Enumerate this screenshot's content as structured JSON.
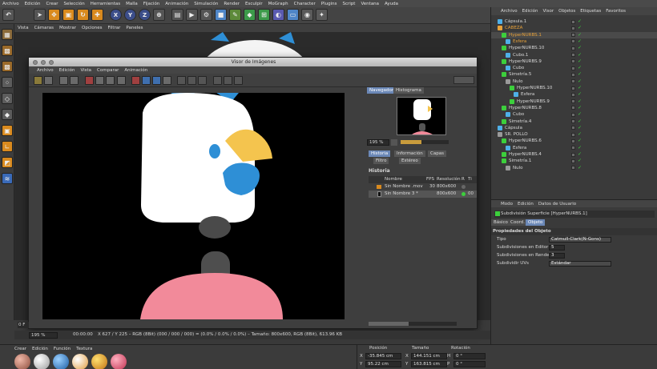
{
  "menubar": [
    "Archivo",
    "Edición",
    "Crear",
    "Selección",
    "Herramientas",
    "Malla",
    "Fijación",
    "Animación",
    "Simulación",
    "Render",
    "Esculpir",
    "MoGraph",
    "Character",
    "Plugins",
    "Script",
    "Ventana",
    "Ayuda"
  ],
  "viewport_menu": [
    "Vista",
    "Cámaras",
    "Mostrar",
    "Opciones",
    "Filtrar",
    "Paneles"
  ],
  "toolbar_axes": [
    "X",
    "Y",
    "Z"
  ],
  "picture_viewer": {
    "title": "Visor de Imágenes",
    "menu": [
      "Archivo",
      "Edición",
      "Vista",
      "Comparar",
      "Animación"
    ],
    "nav_tabs": [
      "Navegador",
      "Histograma"
    ],
    "zoom": "195 %",
    "info_tabs_row1": [
      "Historia",
      "Información",
      "Capas"
    ],
    "info_tabs_row2": [
      "Filtro",
      "Estéreo"
    ],
    "history_title": "Historia",
    "history_columns": [
      "Nombre",
      "FPS",
      "Resolución",
      "R",
      "Ti"
    ],
    "history_rows": [
      {
        "name": "Sin Nombre .mov",
        "fps": "30",
        "res": "800x600",
        "r": "",
        "t": ""
      },
      {
        "name": "Sin Nombre 3 *",
        "fps": "",
        "res": "800x600",
        "r": "",
        "t": "00"
      }
    ],
    "bottom_zoom": "195 %",
    "status_time": "00:00:00",
    "status_text": "X 627 / Y 225 – RGB (8Bit) (000 / 000 / 000) = (0.0% / 0.0% / 0.0%) – Tamaño: 800x600, RGB (8Bit), 613.96 KB"
  },
  "object_manager": {
    "menu": [
      "Archivo",
      "Edición",
      "Visor",
      "Objetos",
      "Etiquetas",
      "Favoritos"
    ],
    "objects": [
      {
        "name": "Cápsula.1",
        "indent": 1,
        "color": "#d8d8d8",
        "icon": "#4fb0e8"
      },
      {
        "name": "CABEZA",
        "indent": 1,
        "color": "#e8a23a",
        "icon": "#e8a23a"
      },
      {
        "name": "HyperNURBS.1",
        "indent": 2,
        "color": "#e8a23a",
        "icon": "#3ccf3c"
      },
      {
        "name": "Esfera",
        "indent": 3,
        "color": "#e8a23a",
        "icon": "#4fb0e8"
      },
      {
        "name": "HyperNURBS.10",
        "indent": 2,
        "color": "#d8d8d8",
        "icon": "#3ccf3c"
      },
      {
        "name": "Cubo.1",
        "indent": 3,
        "color": "#d8d8d8",
        "icon": "#4fb0e8"
      },
      {
        "name": "HyperNURBS.9",
        "indent": 2,
        "color": "#d8d8d8",
        "icon": "#3ccf3c"
      },
      {
        "name": "Cubo",
        "indent": 3,
        "color": "#d8d8d8",
        "icon": "#4fb0e8"
      },
      {
        "name": "Simetría.5",
        "indent": 2,
        "color": "#d8d8d8",
        "icon": "#3ccf3c"
      },
      {
        "name": "Nulo",
        "indent": 3,
        "color": "#d8d8d8",
        "icon": "#9a9a9a"
      },
      {
        "name": "HyperNURBS.10",
        "indent": 4,
        "color": "#d8d8d8",
        "icon": "#3ccf3c"
      },
      {
        "name": "Esfera",
        "indent": 5,
        "color": "#d8d8d8",
        "icon": "#4fb0e8"
      },
      {
        "name": "HyperNURBS.9",
        "indent": 4,
        "color": "#d8d8d8",
        "icon": "#3ccf3c"
      },
      {
        "name": "HyperNURBS.8",
        "indent": 2,
        "color": "#d8d8d8",
        "icon": "#3ccf3c"
      },
      {
        "name": "Cubo",
        "indent": 3,
        "color": "#d8d8d8",
        "icon": "#4fb0e8"
      },
      {
        "name": "Simetría.4",
        "indent": 2,
        "color": "#d8d8d8",
        "icon": "#3ccf3c"
      },
      {
        "name": "Cápsula",
        "indent": 1,
        "color": "#d8d8d8",
        "icon": "#4fb0e8"
      },
      {
        "name": "SR. POLLO",
        "indent": 1,
        "color": "#d8d8d8",
        "icon": "#9a9a9a"
      },
      {
        "name": "HyperNURBS.6",
        "indent": 2,
        "color": "#d8d8d8",
        "icon": "#3ccf3c"
      },
      {
        "name": "Esfera",
        "indent": 3,
        "color": "#d8d8d8",
        "icon": "#4fb0e8"
      },
      {
        "name": "HyperNURBS.4",
        "indent": 2,
        "color": "#d8d8d8",
        "icon": "#3ccf3c"
      },
      {
        "name": "Simetría.1",
        "indent": 2,
        "color": "#d8d8d8",
        "icon": "#3ccf3c"
      },
      {
        "name": "Nulo",
        "indent": 3,
        "color": "#d8d8d8",
        "icon": "#9a9a9a"
      }
    ]
  },
  "attribute_manager": {
    "menu": [
      "Modo",
      "Edición",
      "Datos de Usuario"
    ],
    "object_title": "Subdivisión Superficie [HyperNURBS.1]",
    "tabs": [
      "Básico",
      "Coord.",
      "Objeto"
    ],
    "section": "Propiedades del Objeto",
    "fields": [
      {
        "label": "Tipo",
        "value": "Catmull-Clark(N-Gons)"
      },
      {
        "label": "Subdivisiones en Editor",
        "value": "5"
      },
      {
        "label": "Subdivisiones en Render",
        "value": "3"
      },
      {
        "label": "Subdividir UVs",
        "value": "Estándar"
      }
    ]
  },
  "material_manager": {
    "menu": [
      "Crear",
      "Edición",
      "Función",
      "Textura"
    ]
  },
  "coordinates": {
    "headers": [
      "Posición",
      "Tamaño",
      "Rotación"
    ],
    "rows": [
      {
        "pos_label": "X",
        "pos": "-35.845 cm",
        "size_label": "X",
        "size": "144.151 cm",
        "rot_label": "H",
        "rot": "0 °"
      },
      {
        "pos_label": "Y",
        "pos": "95.22 cm",
        "size_label": "Y",
        "size": "163.815 cm",
        "rot_label": "P",
        "rot": "0 °"
      }
    ]
  },
  "frame_field": "0 F"
}
